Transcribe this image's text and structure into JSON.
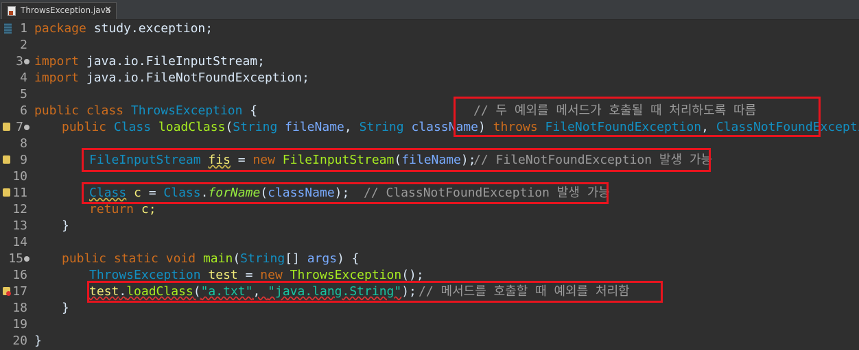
{
  "tab": {
    "label": "ThrowsException.java",
    "close": "✕"
  },
  "lines": {
    "l1": {
      "num": "1",
      "kw1": "package",
      "rest": " study.exception;"
    },
    "l2": {
      "num": "2"
    },
    "l3": {
      "num": "3",
      "kw1": "import",
      "rest": " java.io.FileInputStream;"
    },
    "l4": {
      "num": "4",
      "kw1": "import",
      "rest": " java.io.FileNotFoundException;"
    },
    "l5": {
      "num": "5"
    },
    "l6": {
      "num": "6",
      "kw1": "public",
      "kw2": "class",
      "cls": "ThrowsException",
      "brace": " {",
      "comment": "// 두 예외를 메서드가 호출될 때 처리하도록 따름"
    },
    "l7": {
      "num": "7",
      "kw1": "public",
      "type1": "Class",
      "meth": "loadClass",
      "open": "(",
      "type2": "String",
      "p1": "fileName",
      "comma": ", ",
      "type3": "String",
      "p2": "className",
      "close": ") ",
      "kw2": "throws",
      "ex1": "FileNotFoundException",
      "comma2": ", ",
      "ex2": "ClassNotFoundException",
      "brace": " {"
    },
    "l8": {
      "num": "8"
    },
    "l9": {
      "num": "9",
      "type1": "FileInputStream",
      "var": "fis",
      "eq": " = ",
      "kw1": "new",
      "ctor": "FileInputStream",
      "open": "(",
      "p1": "fileName",
      "close": ");",
      "comment": "// FileNotFoundException 발생 가능"
    },
    "l10": {
      "num": "10"
    },
    "l11": {
      "num": "11",
      "type1": "Class",
      "var": "c",
      "eq": " = ",
      "type2": "Class",
      "dot": ".",
      "call": "forName",
      "open": "(",
      "p1": "className",
      "close": ");",
      "comment": "// ClassNotFoundException 발생 가능"
    },
    "l12": {
      "num": "12",
      "kw1": "return",
      "rest": " c;"
    },
    "l13": {
      "num": "13",
      "rest": "}"
    },
    "l14": {
      "num": "14"
    },
    "l15": {
      "num": "15",
      "kw1": "public",
      "kw2": "static",
      "kw3": "void",
      "meth": "main",
      "open": "(",
      "type1": "String",
      "arr": "[] ",
      "p1": "args",
      "close": ") {"
    },
    "l16": {
      "num": "16",
      "type1": "ThrowsException",
      "var": "test",
      "eq": " = ",
      "kw1": "new",
      "ctor": "ThrowsException",
      "close": "();"
    },
    "l17": {
      "num": "17",
      "var": "test",
      "dot": ".",
      "call": "loadClass",
      "open": "(",
      "s1": "\"a.txt\"",
      "comma": ", ",
      "s2": "\"java.lang.String\"",
      "close": ");",
      "comment": "// 메서드를 호출할 때 예외를 처리함"
    },
    "l18": {
      "num": "18",
      "rest": "}"
    },
    "l19": {
      "num": "19"
    },
    "l20": {
      "num": "20",
      "rest": "}"
    }
  },
  "colors": {
    "keyword": "#cc6c1d",
    "type": "#1290c3",
    "method": "#a7ec21",
    "variable": "#f3ec79",
    "parameter": "#79abff",
    "string": "#17c6a3",
    "comment": "#9a9a9a",
    "highlight_box": "#e8141e"
  }
}
